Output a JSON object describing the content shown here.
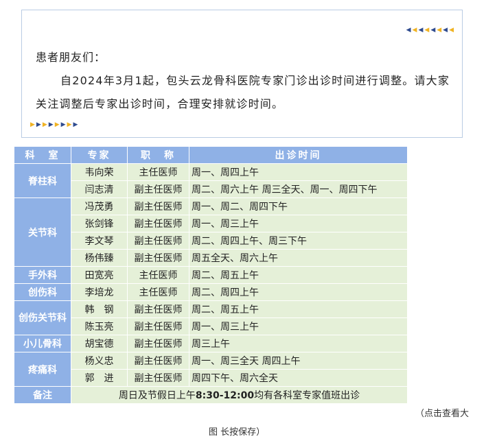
{
  "notice": {
    "greeting": "患者朋友们：",
    "paragraph": "自2024年3月1起，包头云龙骨科医院专家门诊出诊时间进行调整。请大家关注调整后专家出诊时间，合理安排就诊时间。"
  },
  "table": {
    "headers": [
      "科　室",
      "专家",
      "职　称",
      "出诊时间"
    ],
    "depts": {
      "spine": "脊柱科",
      "joint": "关节科",
      "hand": "手外科",
      "trauma": "创伤科",
      "trauma_joint": "创伤关节科",
      "pediatric": "小儿骨科",
      "pain": "疼痛科"
    },
    "rows": [
      {
        "name": "韦向荣",
        "title": "主任医师",
        "time": "周一、周四上午"
      },
      {
        "name": "闫志清",
        "title": "副主任医师",
        "time": "周二、周六上午  周三全天、周一、周四下午"
      },
      {
        "name": "冯茂勇",
        "title": "副主任医师",
        "time": "周一、周二、周四下午"
      },
      {
        "name": "张剑锋",
        "title": "副主任医师",
        "time": "周一、周三上午"
      },
      {
        "name": "李文琴",
        "title": "副主任医师",
        "time": "周二、周四上午、周三下午"
      },
      {
        "name": "杨伟臻",
        "title": "副主任医师",
        "time": "周五全天、周六上午"
      },
      {
        "name": "田宽亮",
        "title": "主任医师",
        "time": "周二、周五上午"
      },
      {
        "name": "李培龙",
        "title": "主任医师",
        "time": "周二、周四上午"
      },
      {
        "name": "韩　钢",
        "title": "副主任医师",
        "time": "周二、周五上午"
      },
      {
        "name": "陈玉亮",
        "title": "副主任医师",
        "time": "周一、周三上午"
      },
      {
        "name": "胡宝德",
        "title": "副主任医师",
        "time": "周三上午"
      },
      {
        "name": "杨义忠",
        "title": "副主任医师",
        "time": "周一、周三全天 周四上午"
      },
      {
        "name": "郭　进",
        "title": "副主任医师",
        "time": "周四下午、周六全天"
      }
    ],
    "note_label": "备注",
    "note_text_pre": "周日及节假日上午",
    "note_time": "8:30-12:00",
    "note_text_post": "均有各科室专家值班出诊"
  },
  "side_note": "（点击查看大",
  "caption": "图 长按保存）",
  "colors": {
    "header_bg": "#8fb1e6",
    "cell_bg": "#e5f0d8",
    "border": "#b9cbe3",
    "arrow_blue": "#2f4b8f",
    "arrow_yellow": "#f0b323"
  }
}
